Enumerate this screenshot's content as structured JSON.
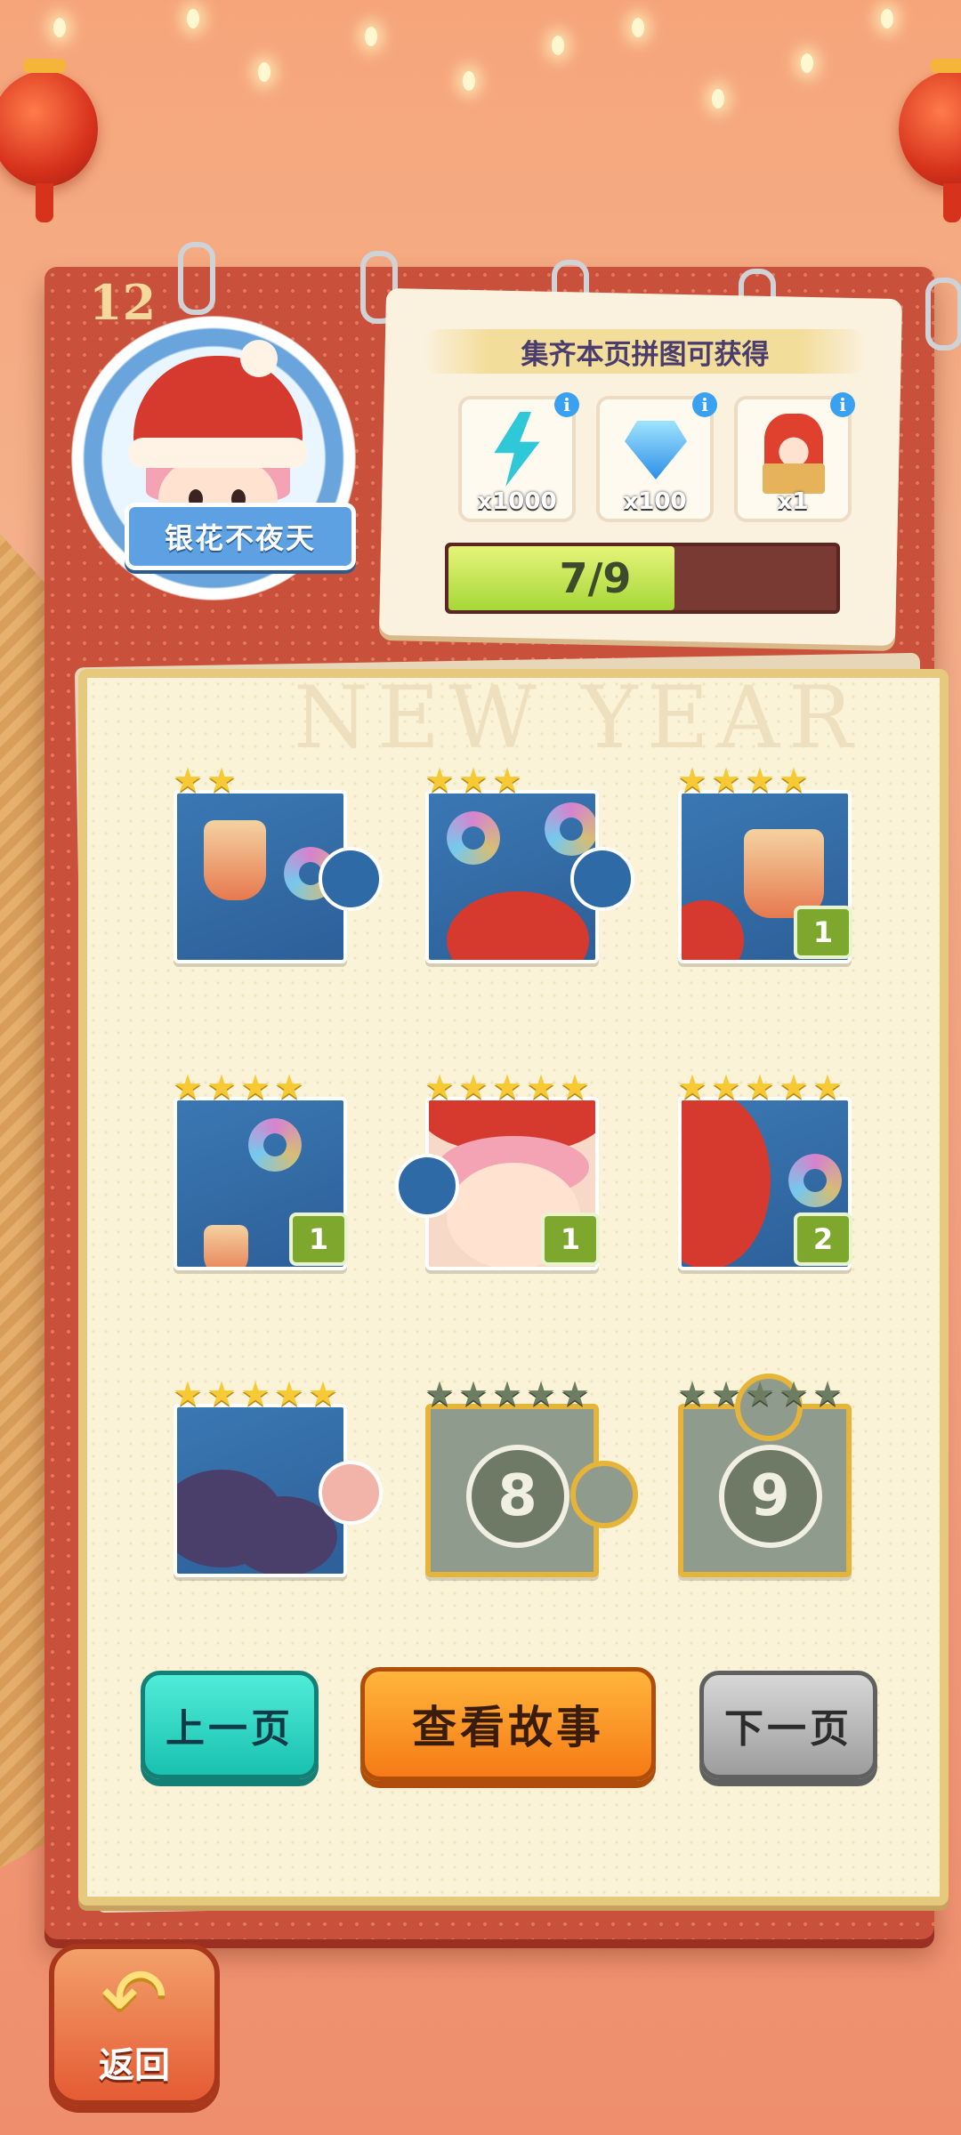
{
  "page": {
    "number": "12",
    "watermark": "NEW YEAR"
  },
  "character": {
    "name": "银花不夜天"
  },
  "rewards": {
    "title": "集齐本页拼图可获得",
    "items": [
      {
        "icon": "energy-bolt-icon",
        "count": "x1000"
      },
      {
        "icon": "diamond-icon",
        "count": "x100"
      },
      {
        "icon": "jester-box-icon",
        "count": "x1"
      }
    ],
    "info_icon": "i",
    "progress": {
      "label": "7/9",
      "current": 7,
      "total": 9
    }
  },
  "puzzles": [
    {
      "stars": [
        "★",
        "★"
      ],
      "dim_stars": [],
      "count": "",
      "locked": false
    },
    {
      "stars": [
        "★",
        "★",
        "★"
      ],
      "dim_stars": [],
      "count": "",
      "locked": false
    },
    {
      "stars": [
        "★",
        "★",
        "★",
        "★"
      ],
      "dim_stars": [],
      "count": "1",
      "locked": false
    },
    {
      "stars": [
        "★",
        "★",
        "★",
        "★"
      ],
      "dim_stars": [],
      "count": "1",
      "locked": false
    },
    {
      "stars": [
        "★",
        "★",
        "★",
        "★",
        "★"
      ],
      "dim_stars": [],
      "count": "1",
      "locked": false
    },
    {
      "stars": [
        "★",
        "★",
        "★",
        "★",
        "★"
      ],
      "dim_stars": [],
      "count": "2",
      "locked": false
    },
    {
      "stars": [
        "★",
        "★",
        "★",
        "★",
        "★"
      ],
      "dim_stars": [],
      "count": "",
      "locked": false
    },
    {
      "stars": [],
      "dim_stars": [
        "★",
        "★",
        "★",
        "★",
        "★"
      ],
      "count": "",
      "locked": true,
      "number": "8"
    },
    {
      "stars": [],
      "dim_stars": [
        "★",
        "★",
        "★",
        "★",
        "★"
      ],
      "count": "",
      "locked": true,
      "number": "9"
    }
  ],
  "buttons": {
    "prev": "上一页",
    "story": "查看故事",
    "next": "下一页",
    "back": "返回",
    "back_icon": "↶"
  },
  "colors": {
    "board": "#c9503b",
    "progress_fill": "#a6d737",
    "prev_button": "#19c1b0",
    "story_button": "#f57b16",
    "next_button": "#9d9d9d"
  }
}
